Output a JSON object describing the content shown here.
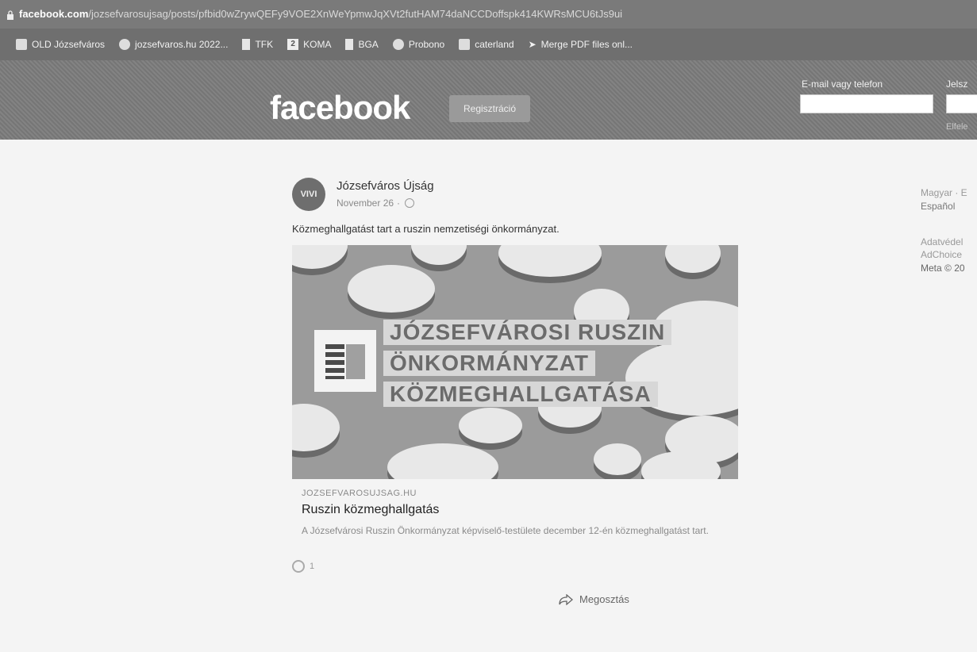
{
  "browser": {
    "url_domain": "facebook.com",
    "url_path": "/jozsefvarosujsag/posts/pfbid0wZrywQEFy9VOE2XnWeYpmwJqXVt2futHAM74daNCCDoffspk414KWRsMCU6tJs9ui",
    "bookmarks": [
      {
        "label": "OLD Józsefváros",
        "icon": "folder-icon"
      },
      {
        "label": "jozsefvaros.hu 2022...",
        "icon": "site-icon"
      },
      {
        "label": "TFK",
        "icon": "doc-icon"
      },
      {
        "label": "KOMA",
        "icon": "number-icon"
      },
      {
        "label": "BGA",
        "icon": "doc-icon"
      },
      {
        "label": "Probono",
        "icon": "globe-icon"
      },
      {
        "label": "caterland",
        "icon": "site-icon"
      },
      {
        "label": "Merge PDF files onl...",
        "icon": "arrow-icon"
      }
    ]
  },
  "header": {
    "logo": "facebook",
    "register_label": "Regisztráció",
    "email_label": "E-mail vagy telefon",
    "password_label": "Jelsz",
    "forgot_label": "Elfele"
  },
  "post": {
    "avatar_text": "VIVI",
    "author": "Józsefváros Újság",
    "date": "November 26",
    "text": "Közmeghallgatást tart a ruszin nemzetiségi önkormányzat.",
    "image_lines": [
      "JÓZSEFVÁROSI RUSZIN",
      "ÖNKORMÁNYZAT",
      "KÖZMEGHALLGATÁSA"
    ],
    "link_domain": "JOZSEFVAROSUJSAG.HU",
    "link_title": "Ruszin közmeghallgatás",
    "link_desc": "A Józsefvárosi Ruszin Önkormányzat képviselő-testülete december 12-én közmeghallgatást tart.",
    "reaction_count": "1",
    "share_label": "Megosztás"
  },
  "footer": {
    "lang1": "Magyar · E",
    "lang2": "Español",
    "privacy": "Adatvédel",
    "adchoices": "AdChoice",
    "meta": "Meta © 20"
  }
}
